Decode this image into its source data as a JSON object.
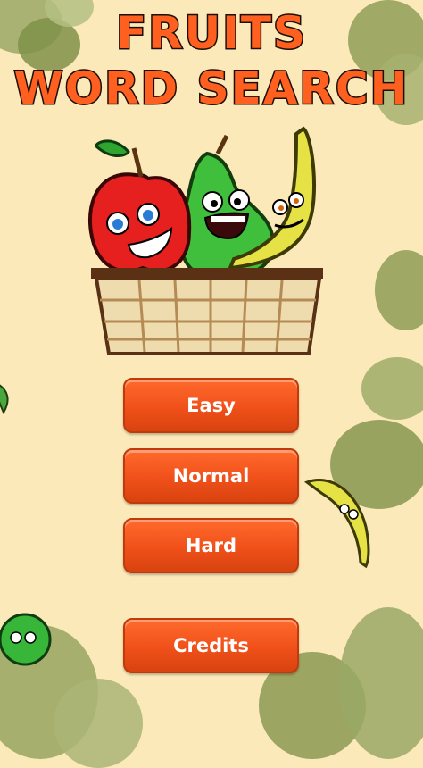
{
  "title": {
    "line1": "FRUITS",
    "line2": "WORD SEARCH"
  },
  "menu": {
    "easy": "Easy",
    "normal": "Normal",
    "hard": "Hard",
    "credits": "Credits"
  },
  "colors": {
    "background": "#fbe9b9",
    "title": "#ff5f1f",
    "button": "#f0501a",
    "leaves": "#8c9b55"
  }
}
